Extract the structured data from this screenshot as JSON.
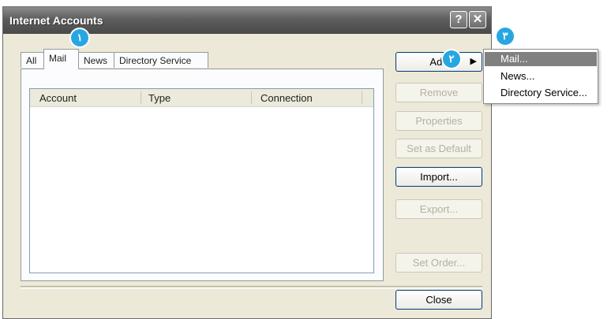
{
  "window": {
    "title": "Internet Accounts"
  },
  "titlebar": {
    "help_label": "?",
    "close_label": "✕"
  },
  "tabs": [
    {
      "label": "All"
    },
    {
      "label": "Mail"
    },
    {
      "label": "News"
    },
    {
      "label": "Directory Service"
    }
  ],
  "list": {
    "columns": [
      "Account",
      "Type",
      "Connection"
    ]
  },
  "buttons": {
    "add": "Add",
    "add_arrow": "▶",
    "remove": "Remove",
    "properties": "Properties",
    "set_default": "Set as Default",
    "import": "Import...",
    "export": "Export...",
    "set_order": "Set Order...",
    "close": "Close"
  },
  "popup": {
    "items": [
      "Mail...",
      "News...",
      "Directory Service..."
    ]
  },
  "markers": [
    "١",
    "٢",
    "٣"
  ],
  "colors": {
    "marker": "#27a7e2",
    "highlight": "#808080"
  }
}
